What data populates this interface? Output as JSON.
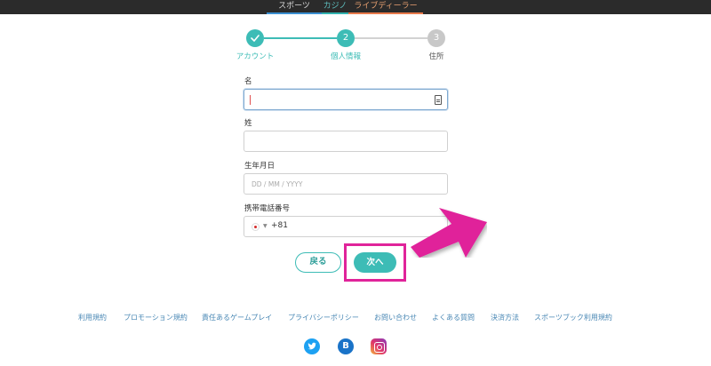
{
  "top_nav": {
    "tabs": [
      {
        "label": "スポーツ",
        "color": "#3a8fd1"
      },
      {
        "label": "カジノ",
        "color": "#32b3b0"
      },
      {
        "label": "ライブディーラー",
        "color": "#e8794a"
      }
    ]
  },
  "stepper": {
    "steps": [
      {
        "number": "",
        "label": "アカウント",
        "state": "completed"
      },
      {
        "number": "2",
        "label": "個人情報",
        "state": "active"
      },
      {
        "number": "3",
        "label": "住所",
        "state": "pending"
      }
    ]
  },
  "form": {
    "first_name": {
      "label": "名",
      "value": ""
    },
    "last_name": {
      "label": "姓",
      "value": ""
    },
    "birthdate": {
      "label": "生年月日",
      "placeholder": "DD / MM / YYYY"
    },
    "phone": {
      "label": "携帯電話番号",
      "country_code": "+81"
    }
  },
  "actions": {
    "back_label": "戻る",
    "next_label": "次へ"
  },
  "footer": {
    "links": [
      "利用規約",
      "プロモーション規約",
      "責任あるゲームプレイ",
      "プライバシーポリシー",
      "お問い合わせ",
      "よくある質問",
      "決済方法",
      "スポーツブック利用規約"
    ],
    "social": [
      {
        "icon": "twitter-icon"
      },
      {
        "icon": "blogger-icon",
        "glyph": "B"
      },
      {
        "icon": "instagram-icon"
      }
    ]
  },
  "colors": {
    "accent": "#3dbcb6",
    "highlight": "#e0249a"
  }
}
